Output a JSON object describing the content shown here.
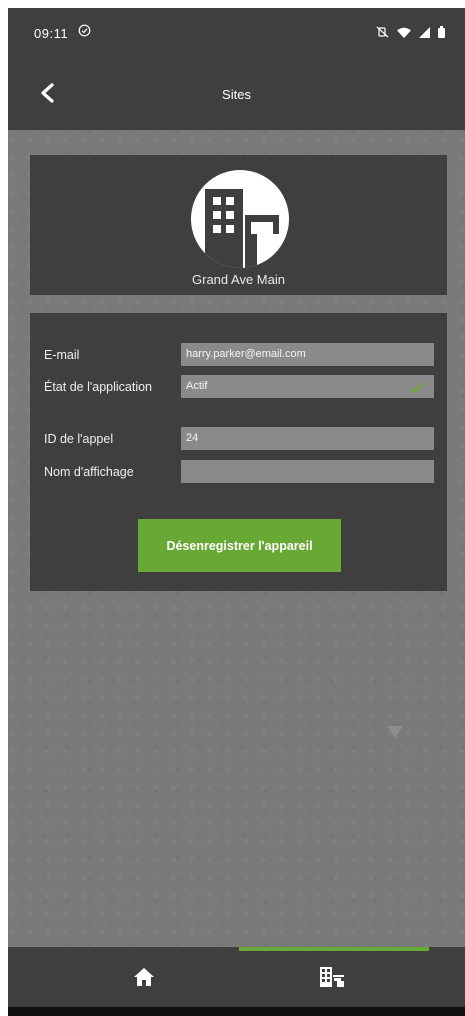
{
  "status_bar": {
    "time": "09:11",
    "sync_icon": "circle-check-icon",
    "icons": [
      "mute-vibrate-icon",
      "wifi-icon",
      "signal-icon",
      "battery-icon"
    ]
  },
  "header": {
    "title": "Sites",
    "back_icon": "chevron-left-icon"
  },
  "site": {
    "name": "Grand Ave Main",
    "icon": "building-icon"
  },
  "form": {
    "email_label": "E-mail",
    "email_value": "harry.parker@email.com",
    "app_state_label": "État de l'application",
    "app_state_value": "Actif",
    "call_id_label": "ID de l'appel",
    "call_id_value": "24",
    "display_name_label": "Nom d'affichage",
    "display_name_value": ""
  },
  "actions": {
    "unregister_label": "Désenregistrer l'appareil"
  },
  "bottom_nav": {
    "items": [
      {
        "icon": "home-icon",
        "active": false
      },
      {
        "icon": "buildings-icon",
        "active": true
      }
    ]
  },
  "colors": {
    "accent": "#68a834",
    "panel": "#3f3f3f",
    "background": "#7a7a7a",
    "field": "#8a8a8a"
  }
}
